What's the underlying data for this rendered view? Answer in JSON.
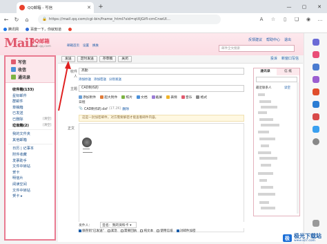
{
  "browser": {
    "tab_title": "QQ邮箱 - 写信",
    "url": "https://mail.qq.com/cgi-bin/frame_html?sid=qtXjGifl-cmCnwUl...",
    "favorites": [
      {
        "label": "腾讯网",
        "color": "#1a73e8"
      },
      {
        "label": "百度一下，你就知道",
        "color": "#2f6bd9"
      },
      {
        "label": "",
        "color": "#e9412d"
      }
    ]
  },
  "mail_header": {
    "logo_letters": "MaiL",
    "logo_name": "QQ邮箱",
    "logo_domain": "mail.qq.com",
    "user_name": "",
    "user_links": [
      "邮箱首页",
      "设置",
      "换肤"
    ],
    "right_links": [
      "反馈建议",
      "帮助中心",
      "退出"
    ],
    "search_placeholder": "邮件全文搜索"
  },
  "sidebar": {
    "write_label": "写信",
    "inbox_label": "收信",
    "contacts_label": "通讯录",
    "folders": [
      {
        "label": "收件箱(133)",
        "bold": true,
        "note": ""
      },
      {
        "label": "星标邮件",
        "bold": false,
        "note": ""
      },
      {
        "label": "群邮件",
        "bold": false,
        "note": ""
      },
      {
        "label": "草稿箱",
        "bold": false,
        "note": ""
      },
      {
        "label": "已发送",
        "bold": false,
        "note": ""
      },
      {
        "label": "已删除",
        "bold": false,
        "note": "[清空]"
      },
      {
        "label": "垃圾箱(2)",
        "bold": true,
        "note": "[清空]"
      },
      {
        "label": "我的文件夹",
        "bold": false,
        "note": ""
      },
      {
        "label": "其他邮箱",
        "bold": false,
        "note": ""
      },
      {
        "label": "日历 | 记事本",
        "bold": false,
        "note": ""
      },
      {
        "label": "附件收藏",
        "bold": false,
        "note": ""
      },
      {
        "label": "发票助手",
        "bold": false,
        "note": ""
      },
      {
        "label": "文件中转站",
        "bold": false,
        "note": ""
      },
      {
        "label": "贺卡",
        "bold": false,
        "note": ""
      },
      {
        "label": "明信片",
        "bold": false,
        "note": ""
      },
      {
        "label": "阅读空间",
        "bold": false,
        "note": ""
      },
      {
        "label": "文件中转站",
        "bold": false,
        "note": ""
      },
      {
        "label": "贺卡 ▸",
        "bold": false,
        "note": ""
      }
    ]
  },
  "toolbar": {
    "send": "发送",
    "scheduled": "定时发送",
    "save_draft": "存草稿",
    "close": "关闭",
    "right_links": [
      "投诉",
      "新窗口写信"
    ]
  },
  "compose": {
    "to_label": "收件人",
    "to_value": "高勤",
    "to_links": [
      "添加抄送",
      "添加密送",
      "分别发送"
    ],
    "subject_label": "主题",
    "subject_value": "CAD制作的",
    "attach_items": [
      "添加附件",
      "超大附件",
      "照片",
      "文档",
      "截屏",
      "表情",
      "音乐",
      "格式"
    ],
    "attach_row2": "日程",
    "attachment_file": "CAD制作的.dxf",
    "attachment_size": "(17.2K)",
    "attachment_delete": "删除",
    "warning": "这是一封加密邮件，对方需要解密才能查看邮件内容。",
    "body_label": "正文",
    "sender_label": "发件人：",
    "signature_label": "签名：我的资料卡 ▾",
    "options": [
      {
        "label": "保存到\"已发送\"",
        "checked": true
      },
      {
        "label": "紧急",
        "checked": false
      },
      {
        "label": "需要回执",
        "checked": false
      },
      {
        "label": "纯文本",
        "checked": false
      },
      {
        "label": "使用信纸",
        "checked": false
      },
      {
        "label": "对邮件加密",
        "checked": true
      }
    ]
  },
  "contacts": {
    "tab_contacts": "通讯录",
    "tab_other": "信 纸",
    "group_recent": "最近联系人",
    "group_extra": "读空"
  },
  "watermark": {
    "badge": "极",
    "text": "极光下载站",
    "url": "www.xz7.com"
  },
  "colors": {
    "accent": "#e97a90",
    "link": "#1a5ca8",
    "annotation": "#e02020"
  }
}
